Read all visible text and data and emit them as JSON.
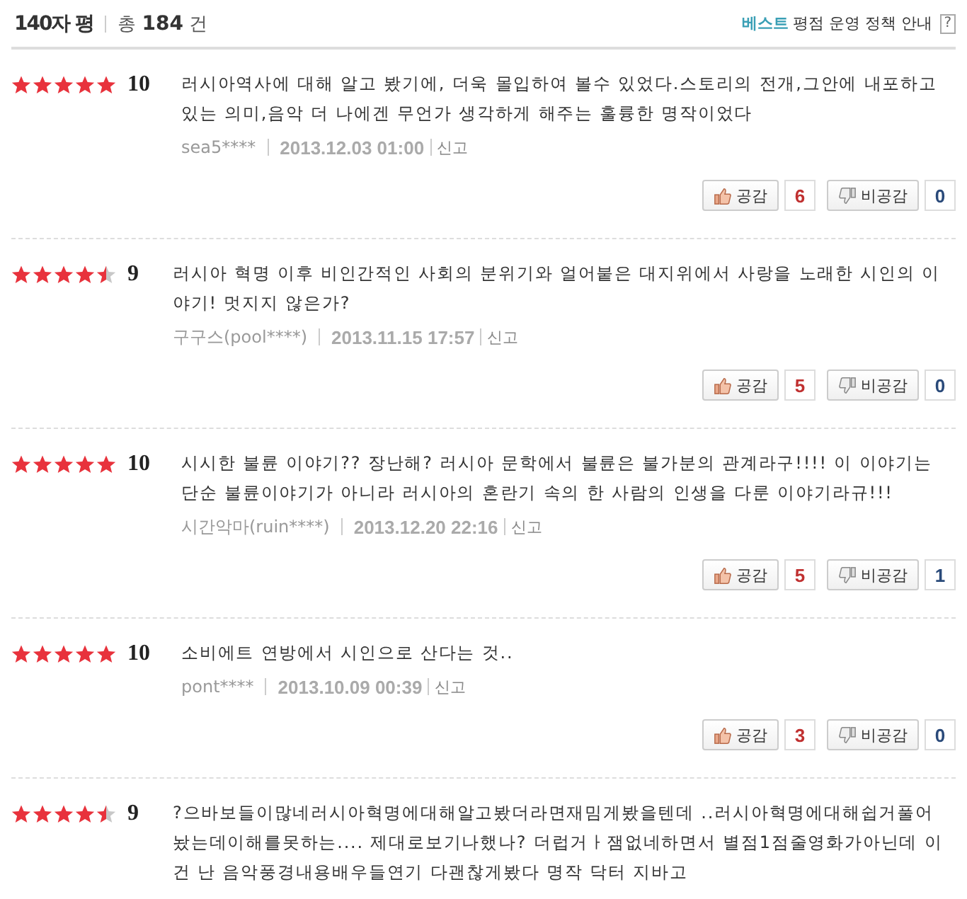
{
  "header": {
    "title": "140자 평",
    "total": "총 **184** 건",
    "best_label": "베스트",
    "policy_link": "평점 운영 정책 안내",
    "help": "?"
  },
  "reviews": [
    {
      "stars": 5,
      "score": "10",
      "text": "러시아역사에 대해 알고 봤기에, 더욱 몰입하여 볼수 있었다.스토리의 전개,그안에 내포하고 있는 의미,음악 더 나에겐 무언가 생각하게 해주는 훌륭한 명작이었다",
      "author": "sea5****",
      "date": "2013.12.03 01:00",
      "report": "신고",
      "like_label": "공감",
      "likes": "6",
      "dislike_label": "비공감",
      "dislikes": "0"
    },
    {
      "stars": 4.5,
      "score": "9",
      "text": "러시아 혁명 이후 비인간적인 사회의 분위기와 얼어붙은 대지위에서 사랑을 노래한 시인의 이야기! 멋지지 않은가?",
      "author": "구구스(pool****)",
      "date": "2013.11.15 17:57",
      "report": "신고",
      "like_label": "공감",
      "likes": "5",
      "dislike_label": "비공감",
      "dislikes": "0"
    },
    {
      "stars": 5,
      "score": "10",
      "text": "시시한 불륜 이야기?? 장난해? 러시아 문학에서 불륜은 불가분의 관계라구!!!! 이 이야기는 단순 불륜이야기가 아니라 러시아의 혼란기 속의 한 사람의 인생을 다룬 이야기라규!!!",
      "author": "시간악마(ruin****)",
      "date": "2013.12.20 22:16",
      "report": "신고",
      "like_label": "공감",
      "likes": "5",
      "dislike_label": "비공감",
      "dislikes": "1"
    },
    {
      "stars": 5,
      "score": "10",
      "text": "소비에트 연방에서 시인으로 산다는 것..",
      "author": "pont****",
      "date": "2013.10.09 00:39",
      "report": "신고",
      "like_label": "공감",
      "likes": "3",
      "dislike_label": "비공감",
      "dislikes": "0"
    },
    {
      "stars": 4.5,
      "score": "9",
      "text": "?으바보들이많네러시아혁명에대해알고봤더라면재밈게봤을텐데 ..러시아혁명에대해쉽거풀어놨는데이해를못하는.... 제대로보기나했나? 더럽거ㅏ잼없네하면서 별점1점줄영화가아닌데 이건 난 음악풍경내용배우들연기 다괜찮게봤다 명작 닥터 지바고"
    }
  ]
}
